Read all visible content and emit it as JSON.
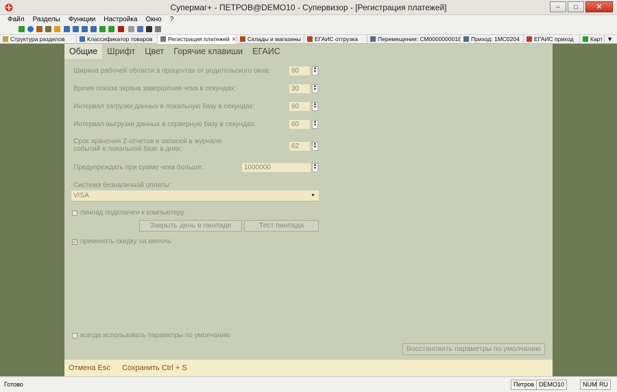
{
  "window": {
    "title": "Супермаг+ - ПЕТРОВ@DEMO10 - Супервизор  - [Регистрация платежей]"
  },
  "menu": [
    "Файл",
    "Разделы",
    "Функции",
    "Настройка",
    "Окно",
    "?"
  ],
  "doc_tabs": [
    {
      "label": "Структура разделов"
    },
    {
      "label": "Классификатор товаров"
    },
    {
      "label": "Регистрация платежей"
    },
    {
      "label": "Склады и магазины"
    },
    {
      "label": "ЕГАИС отгрузка"
    },
    {
      "label": "Перемещение: СМ0000000018"
    },
    {
      "label": "Приход: 1МС0204"
    },
    {
      "label": "ЕГАИС приход"
    },
    {
      "label": "Карт"
    }
  ],
  "content_tabs": [
    "Общие",
    "Шрифт",
    "Цвет",
    "Горячие клавиши",
    "ЕГАИС"
  ],
  "settings": {
    "work_area_label": "Ширина рабочей области в процентах от родительского окна:",
    "work_area_value": "80",
    "receipt_time_label": "Время показа экрана завершения чека в секундах:",
    "receipt_time_value": "30",
    "load_interval_label": "Интервал загрузки данных в локальную базу в секундах:",
    "load_interval_value": "60",
    "upload_interval_label": "Интервал выгрузки данных в серверную базу в секундах:",
    "upload_interval_value": "60",
    "z_reports_label_1": "Срок хранения Z-отчетов и записей в журнале",
    "z_reports_label_2": "событий в локальной базе в днях:",
    "z_reports_value": "62",
    "warn_sum_label": "Предупреждать при сумме чека больше:",
    "warn_sum_value": "1000000",
    "cashless_label": "Система безналичной оплаты:",
    "cashless_value": "VISA",
    "pinpad_connected": "пинпад подключен к компьютеру",
    "close_day_btn": "Закрыть день в пинпаде",
    "test_pinpad_btn": "Тест пинпада",
    "apply_discount": "применять скидку на мелочь",
    "always_defaults": "всегда использовать параметры по умолчанию",
    "restore_defaults_btn": "Восстановить параметры по умолчанию"
  },
  "footer": {
    "cancel": "Отмена Esc",
    "save": "Сохранить Ctrl + S"
  },
  "status": {
    "ready": "Готово",
    "user": "Петров",
    "db": "DEMO10",
    "num": "NUM",
    "lang": "RU"
  }
}
